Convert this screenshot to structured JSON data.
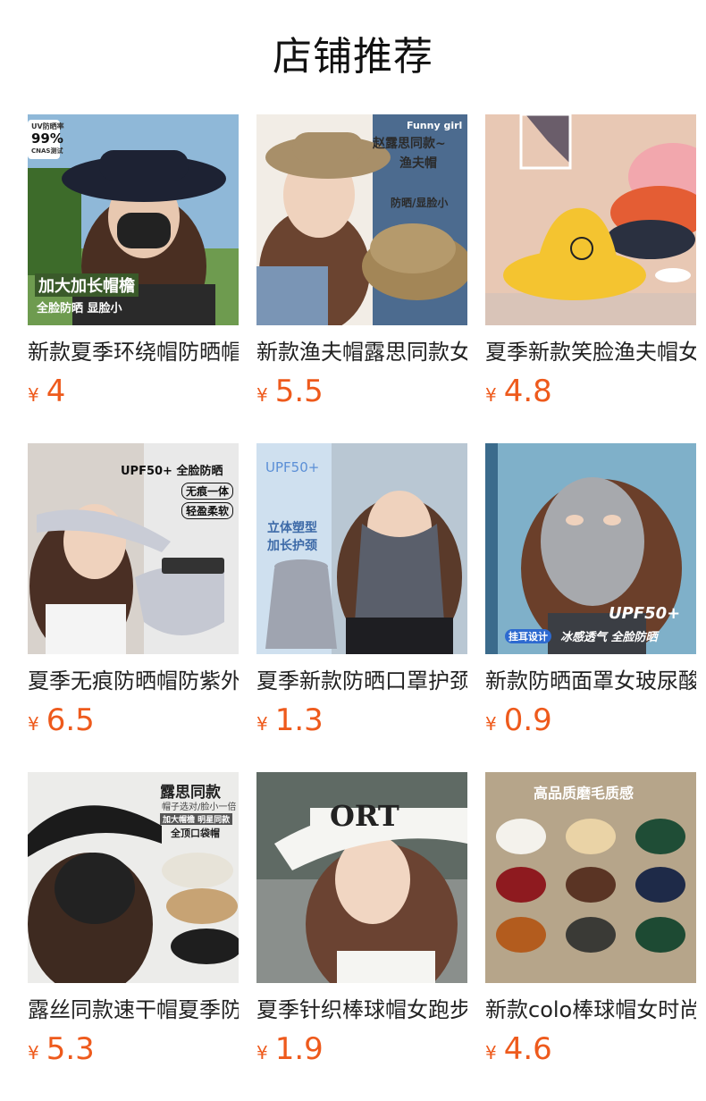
{
  "page": {
    "title": "店铺推荐"
  },
  "products": [
    {
      "name": "新款夏季环绕帽防晒帽",
      "currency": "¥",
      "price": "4",
      "image": {
        "badge_line1": "UV防晒率",
        "badge_line2": "99%",
        "badge_line3": "CNAS测试",
        "caption1": "加大加长帽檐",
        "caption2": "全脸防晒 显脸小"
      }
    },
    {
      "name": "新款渔夫帽露思同款女",
      "currency": "¥",
      "price": "5.5",
      "image": {
        "line1": "Funny girl",
        "line2": "赵露思同款~",
        "line3": "渔夫帽",
        "line4": "防晒/显脸小"
      }
    },
    {
      "name": "夏季新款笑脸渔夫帽女",
      "currency": "¥",
      "price": "4.8",
      "image": {}
    },
    {
      "name": "夏季无痕防晒帽防紫外",
      "currency": "¥",
      "price": "6.5",
      "image": {
        "line1": "UPF50+ 全脸防晒",
        "tag1": "无痕一体",
        "tag2": "轻盈柔软"
      }
    },
    {
      "name": "夏季新款防晒口罩护颈",
      "currency": "¥",
      "price": "1.3",
      "image": {
        "line1": "UPF50+",
        "line2": "立体塑型",
        "line3": "加长护颈"
      }
    },
    {
      "name": "新款防晒面罩女玻尿酸",
      "currency": "¥",
      "price": "0.9",
      "image": {
        "line1": "UPF50+",
        "tag1": "挂耳设计",
        "line2": "冰感透气 全脸防晒"
      }
    },
    {
      "name": "露丝同款速干帽夏季防",
      "currency": "¥",
      "price": "5.3",
      "image": {
        "line1": "露思同款",
        "line2": "帽子选对/脸小一倍",
        "line3": "加大帽檐 明星同款",
        "line4": "全顶口袋帽"
      }
    },
    {
      "name": "夏季针织棒球帽女跑步",
      "currency": "¥",
      "price": "1.9",
      "image": {
        "line1": "ORT"
      }
    },
    {
      "name": "新款colo棒球帽女时尚",
      "currency": "¥",
      "price": "4.6",
      "image": {
        "line1": "高品质磨毛质感"
      }
    }
  ]
}
